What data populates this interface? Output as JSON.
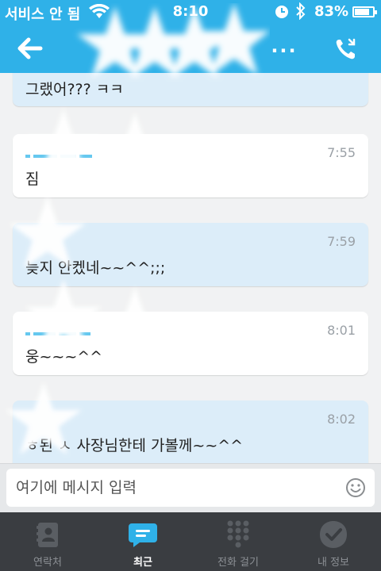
{
  "status_bar": {
    "carrier": "서비스 안 됨",
    "time": "8:10",
    "battery_percent": "83%",
    "battery_level": 0.83
  },
  "nav_bar": {
    "more_label": "..."
  },
  "messages": [
    {
      "direction": "out",
      "time": "",
      "text": "그랬어??? ㅋㅋ"
    },
    {
      "direction": "in",
      "time": "7:55",
      "text": "짐"
    },
    {
      "direction": "out",
      "time": "7:59",
      "text": "늦지 안켔네~~^^;;;"
    },
    {
      "direction": "in",
      "time": "8:01",
      "text": "웅~~~^^"
    },
    {
      "direction": "out",
      "time": "8:02",
      "text": "ㅎ된 ㅅ 사장님한테 가볼께~~^^"
    }
  ],
  "composer": {
    "placeholder": "여기에 메시지 입력"
  },
  "tabs": [
    {
      "label": "연락처",
      "icon": "contacts-icon",
      "active": false
    },
    {
      "label": "최근",
      "icon": "recent-chat-icon",
      "active": true
    },
    {
      "label": "전화 걸기",
      "icon": "dialpad-icon",
      "active": false
    },
    {
      "label": "내 정보",
      "icon": "profile-check-icon",
      "active": false
    }
  ],
  "colors": {
    "brand": "#2fb1e8",
    "outgoing_bubble": "#dcedf9",
    "incoming_bubble": "#ffffff",
    "tab_bar": "#3a3d41"
  }
}
